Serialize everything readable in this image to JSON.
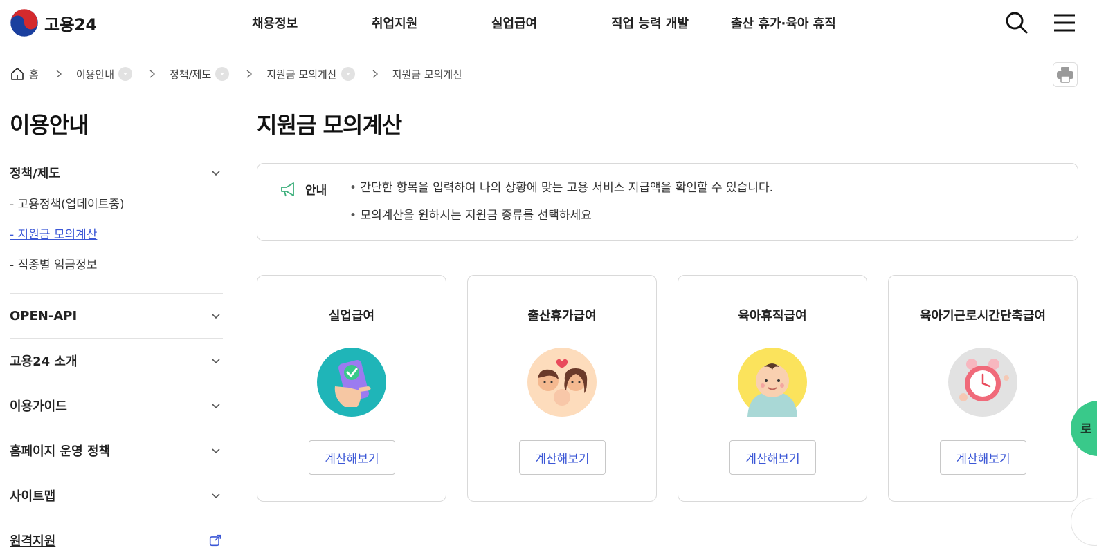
{
  "header": {
    "logo_text": "고용24",
    "nav": [
      "채용정보",
      "취업지원",
      "실업급여",
      "직업 능력 개발",
      "출산 휴가·육아 휴직"
    ]
  },
  "breadcrumb": {
    "home": "홈",
    "items": [
      "이용안내",
      "정책/제도",
      "지원금 모의계산",
      "지원금 모의계산"
    ]
  },
  "sidebar": {
    "title": "이용안내",
    "groups": [
      {
        "label": "정책/제도",
        "items": [
          "- 고용정책(업데이트중)",
          "- 지원금 모의계산",
          "- 직종별 임금정보"
        ],
        "active_index": 1
      },
      {
        "label": "OPEN-API"
      },
      {
        "label": "고용24 소개"
      },
      {
        "label": "이용가이드"
      },
      {
        "label": "홈페이지 운영 정책"
      },
      {
        "label": "사이트맵"
      },
      {
        "label": "원격지원"
      }
    ]
  },
  "main": {
    "title": "지원금 모의계산",
    "notice": {
      "label": "안내",
      "lines": [
        "간단한 항목을 입력하여 나의 상황에 맞는 고용 서비스 지급액을 확인할 수 있습니다.",
        "모의계산을 원하시는 지원금 종류를 선택하세요"
      ]
    },
    "cards": [
      {
        "title": "실업급여",
        "button": "계산해보기",
        "icon": "phone-check-icon"
      },
      {
        "title": "출산휴가급여",
        "button": "계산해보기",
        "icon": "family-icon"
      },
      {
        "title": "육아휴직급여",
        "button": "계산해보기",
        "icon": "baby-icon"
      },
      {
        "title": "육아기근로시간단축급여",
        "button": "계산해보기",
        "icon": "alarm-clock-icon"
      }
    ]
  },
  "floating": {
    "label": "로"
  },
  "colors": {
    "accent": "#3b57d6",
    "float_green": "#39c98a",
    "border": "#d9d9d9"
  }
}
